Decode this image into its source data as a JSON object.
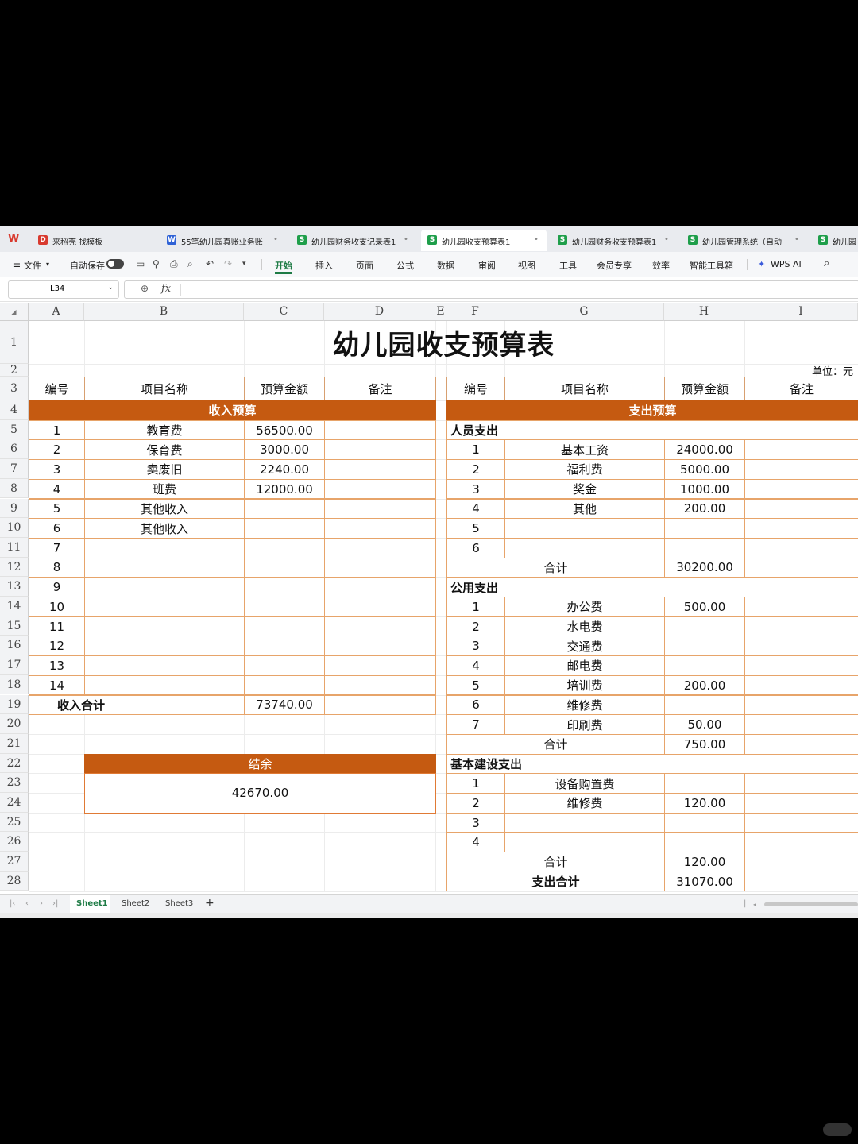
{
  "tabs": [
    {
      "label": "来稻壳 找模板",
      "icon": "D",
      "color": "#d83a2f"
    },
    {
      "label": "55笔幼儿园真账业务账",
      "icon": "W",
      "color": "#2f62d6"
    },
    {
      "label": "幼儿园财务收支记录表1",
      "icon": "S",
      "color": "#1e9e4a"
    },
    {
      "label": "幼儿园收支预算表1",
      "icon": "S",
      "color": "#1e9e4a"
    },
    {
      "label": "幼儿园财务收支预算表1",
      "icon": "S",
      "color": "#1e9e4a"
    },
    {
      "label": "幼儿园管理系统（自动",
      "icon": "S",
      "color": "#1e9e4a"
    },
    {
      "label": "幼儿园",
      "icon": "S",
      "color": "#1e9e4a"
    }
  ],
  "menu": {
    "file": "文件",
    "autosave": "自动保存",
    "items": [
      "开始",
      "插入",
      "页面",
      "公式",
      "数据",
      "审阅",
      "视图",
      "工具",
      "会员专享",
      "效率",
      "智能工具箱"
    ],
    "wps_ai": "WPS AI"
  },
  "formula_bar": {
    "cell_ref": "L34",
    "fx": "fx",
    "content": ""
  },
  "columns": [
    "A",
    "B",
    "C",
    "D",
    "E",
    "F",
    "G",
    "H",
    "I"
  ],
  "rows": [
    "1",
    "2",
    "3",
    "4",
    "5",
    "6",
    "7",
    "8",
    "9",
    "10",
    "11",
    "12",
    "13",
    "14",
    "15",
    "16",
    "17",
    "18",
    "19",
    "20",
    "21",
    "22",
    "23",
    "24",
    "25",
    "26",
    "27",
    "28"
  ],
  "sheet": {
    "title": "幼儿园收支预算表",
    "unit": "单位：元",
    "headers": {
      "no": "编号",
      "name": "项目名称",
      "amount": "预算金额",
      "note": "备注"
    },
    "income": {
      "band": "收入预算",
      "rows": [
        {
          "no": "1",
          "name": "教育费",
          "amount": "56500.00"
        },
        {
          "no": "2",
          "name": "保育费",
          "amount": "3000.00"
        },
        {
          "no": "3",
          "name": "卖废旧",
          "amount": "2240.00"
        },
        {
          "no": "4",
          "name": "班费",
          "amount": "12000.00"
        },
        {
          "no": "5",
          "name": "其他收入",
          "amount": ""
        },
        {
          "no": "6",
          "name": "其他收入",
          "amount": ""
        },
        {
          "no": "7",
          "name": "",
          "amount": ""
        },
        {
          "no": "8",
          "name": "",
          "amount": ""
        },
        {
          "no": "9",
          "name": "",
          "amount": ""
        },
        {
          "no": "10",
          "name": "",
          "amount": ""
        },
        {
          "no": "11",
          "name": "",
          "amount": ""
        },
        {
          "no": "12",
          "name": "",
          "amount": ""
        },
        {
          "no": "13",
          "name": "",
          "amount": ""
        },
        {
          "no": "14",
          "name": "",
          "amount": ""
        }
      ],
      "total_label": "收入合计",
      "total": "73740.00"
    },
    "balance": {
      "label": "结余",
      "value": "42670.00"
    },
    "expense": {
      "band": "支出预算",
      "groups": [
        {
          "title": "人员支出",
          "rows": [
            {
              "no": "1",
              "name": "基本工资",
              "amount": "24000.00"
            },
            {
              "no": "2",
              "name": "福利费",
              "amount": "5000.00"
            },
            {
              "no": "3",
              "name": "奖金",
              "amount": "1000.00"
            },
            {
              "no": "4",
              "name": "其他",
              "amount": "200.00"
            },
            {
              "no": "5",
              "name": "",
              "amount": ""
            },
            {
              "no": "6",
              "name": "",
              "amount": ""
            }
          ],
          "subtotal_label": "合计",
          "subtotal": "30200.00"
        },
        {
          "title": "公用支出",
          "rows": [
            {
              "no": "1",
              "name": "办公费",
              "amount": "500.00"
            },
            {
              "no": "2",
              "name": "水电费",
              "amount": ""
            },
            {
              "no": "3",
              "name": "交通费",
              "amount": ""
            },
            {
              "no": "4",
              "name": "邮电费",
              "amount": ""
            },
            {
              "no": "5",
              "name": "培训费",
              "amount": "200.00"
            },
            {
              "no": "6",
              "name": "维修费",
              "amount": ""
            },
            {
              "no": "7",
              "name": "印刷费",
              "amount": "50.00"
            }
          ],
          "subtotal_label": "合计",
          "subtotal": "750.00"
        },
        {
          "title": "基本建设支出",
          "rows": [
            {
              "no": "1",
              "name": "设备购置费",
              "amount": ""
            },
            {
              "no": "2",
              "name": "维修费",
              "amount": "120.00"
            },
            {
              "no": "3",
              "name": "",
              "amount": ""
            },
            {
              "no": "4",
              "name": "",
              "amount": ""
            }
          ],
          "subtotal_label": "合计",
          "subtotal": "120.00"
        }
      ],
      "total_label": "支出合计",
      "total": "31070.00"
    }
  },
  "sheet_tabs": [
    "Sheet1",
    "Sheet2",
    "Sheet3"
  ],
  "colors": {
    "band": "#c55a11",
    "border": "#e7a46a",
    "accent": "#1e7b45"
  }
}
